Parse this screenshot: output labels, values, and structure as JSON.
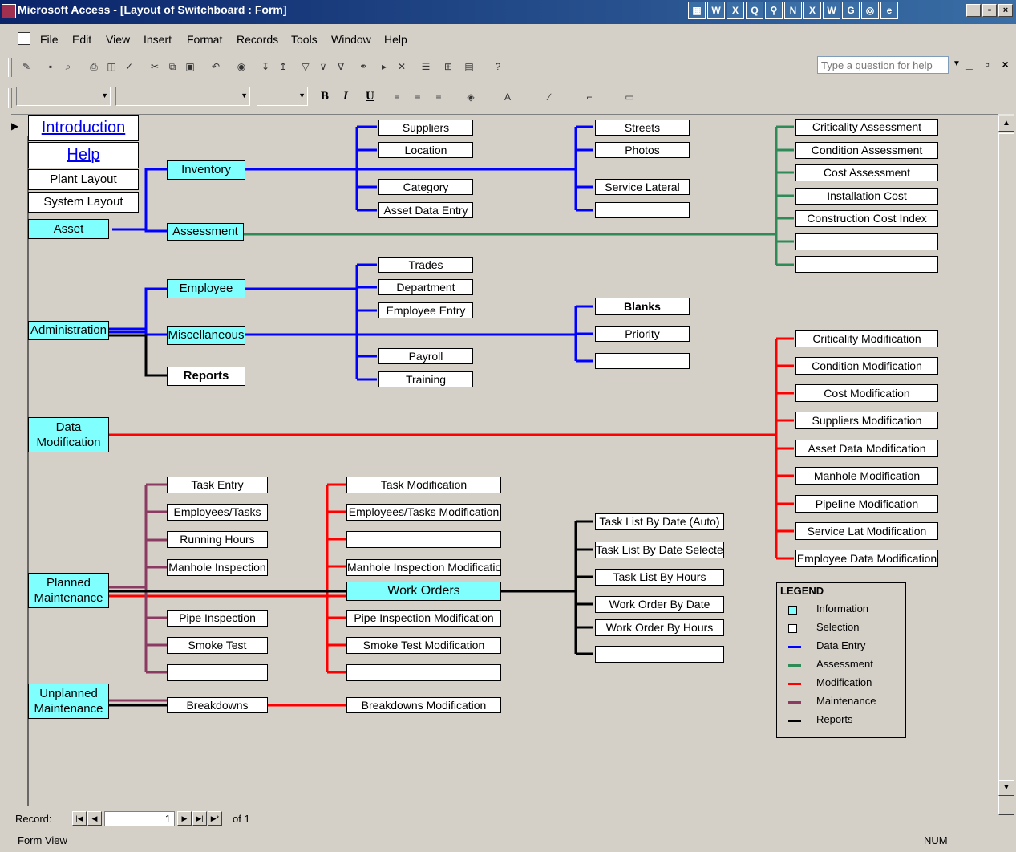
{
  "window": {
    "title": "Microsoft Access - [Layout of Switchboard : Form]",
    "tray_icons": [
      "form-icon",
      "word-icon",
      "excel-icon",
      "query-icon",
      "search-icon",
      "n-icon",
      "x-icon",
      "w-icon",
      "g-icon",
      "globe-icon",
      "ie-icon"
    ],
    "buttons": [
      "_",
      "▫",
      "×"
    ]
  },
  "menu": {
    "items": [
      "File",
      "Edit",
      "View",
      "Insert",
      "Format",
      "Records",
      "Tools",
      "Window",
      "Help"
    ],
    "help_placeholder": "Type a question for help"
  },
  "format_toolbar": {
    "bold": "B",
    "italic": "I",
    "underline": "U"
  },
  "switchboard": {
    "left": {
      "introduction": "Introduction",
      "help": "Help",
      "plant_layout": "Plant Layout",
      "system_layout": "System Layout",
      "asset": "Asset",
      "administration": "Administration",
      "data_modification": "Data Modification",
      "planned_maintenance": "Planned Maintenance",
      "unplanned_maintenance": "Unplanned Maintenance"
    },
    "asset": {
      "inventory": "Inventory",
      "assessment": "Assessment",
      "inventory_items": [
        "Suppliers",
        "Location",
        "Category",
        "Asset Data Entry"
      ],
      "inventory_right": [
        "Streets",
        "Photos",
        "Service Lateral",
        ""
      ],
      "assessment_items": [
        "Criticality Assessment",
        "Condition Assessment",
        "Cost Assessment",
        "Installation Cost",
        "Construction Cost Index",
        "",
        ""
      ]
    },
    "admin": {
      "employee": "Employee",
      "miscellaneous": "Miscellaneous",
      "reports": "Reports",
      "employee_items": [
        "Trades",
        "Department",
        "Employee Entry",
        "Payroll",
        "Training"
      ],
      "misc_items": [
        "Blanks",
        "Priority",
        ""
      ]
    },
    "modification_items": [
      "Criticality Modification",
      "Condition Modification",
      "Cost Modification",
      "Suppliers Modification",
      "Asset Data Modification",
      "Manhole Modification",
      "Pipeline Modification",
      "Service Lat  Modification",
      "Employee Data Modification"
    ],
    "planned": {
      "items": [
        "Task Entry",
        "Employees/Tasks",
        "Running Hours",
        "Manhole Inspection",
        "Pipe Inspection",
        "Smoke Test",
        ""
      ],
      "mod_items": [
        "Task Modification",
        "Employees/Tasks Modification",
        "",
        "Manhole Inspection Modification",
        "Pipe Inspection Modification",
        "Smoke Test Modification",
        ""
      ],
      "work_orders": "Work Orders",
      "report_items": [
        "Task List By Date (Auto)",
        "Task List By Date Selected",
        "Task List By Hours",
        "Work Order By Date",
        "Work Order By Hours",
        ""
      ]
    },
    "unplanned": {
      "breakdowns": "Breakdowns",
      "breakdowns_mod": "Breakdowns Modification"
    }
  },
  "legend": {
    "title": "LEGEND",
    "items": [
      {
        "label": "Information",
        "kind": "box",
        "color": "#80ffff"
      },
      {
        "label": "Selection",
        "kind": "box",
        "color": "#ffffff"
      },
      {
        "label": "Data Entry",
        "kind": "line",
        "color": "#0000ff"
      },
      {
        "label": "Assessment",
        "kind": "line",
        "color": "#2e8b57"
      },
      {
        "label": "Modification",
        "kind": "line",
        "color": "#ff0000"
      },
      {
        "label": "Maintenance",
        "kind": "line",
        "color": "#8b3a62"
      },
      {
        "label": "Reports",
        "kind": "line",
        "color": "#000000"
      }
    ]
  },
  "record_nav": {
    "label": "Record:",
    "current": "1",
    "total_text": "of 1"
  },
  "status": {
    "left": "Form View",
    "num": "NUM"
  }
}
